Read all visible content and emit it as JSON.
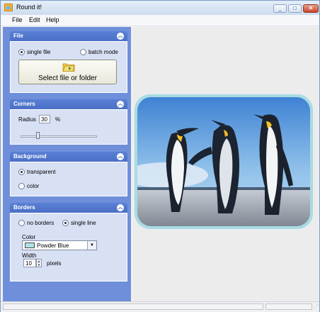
{
  "window": {
    "title": "Round it!",
    "controls": [
      "_",
      "□",
      "✕"
    ]
  },
  "menu": [
    "File",
    "Edit",
    "Help"
  ],
  "icons": {
    "collapse": "chevron-up-icon",
    "folder": "folder-icon",
    "dropdown": "chevron-down-icon"
  },
  "file_panel": {
    "title": "File",
    "mode_single": "single file",
    "mode_batch": "batch mode",
    "selected_mode": "single file",
    "select_button": "Select file or folder"
  },
  "corners_panel": {
    "title": "Corners",
    "radius_label": "Radius",
    "radius_value": "30",
    "radius_unit": "%",
    "radius_slider_fraction": 0.3
  },
  "background_panel": {
    "title": "Background",
    "option_transparent": "transparent",
    "option_color": "color",
    "selected": "transparent"
  },
  "borders_panel": {
    "title": "Borders",
    "option_none": "no borders",
    "option_single": "single line",
    "selected": "single line",
    "color_label": "Color",
    "color_value": "Powder Blue",
    "color_hex": "#b0e0e6",
    "width_label": "Width",
    "width_value": "10",
    "width_unit": "pixels"
  },
  "colors": {
    "panel_header": "#4a6fc5",
    "pane_bg": "#6f8fdb",
    "panel_body": "#d8e0f4",
    "border_color": "#a9dbe3"
  }
}
